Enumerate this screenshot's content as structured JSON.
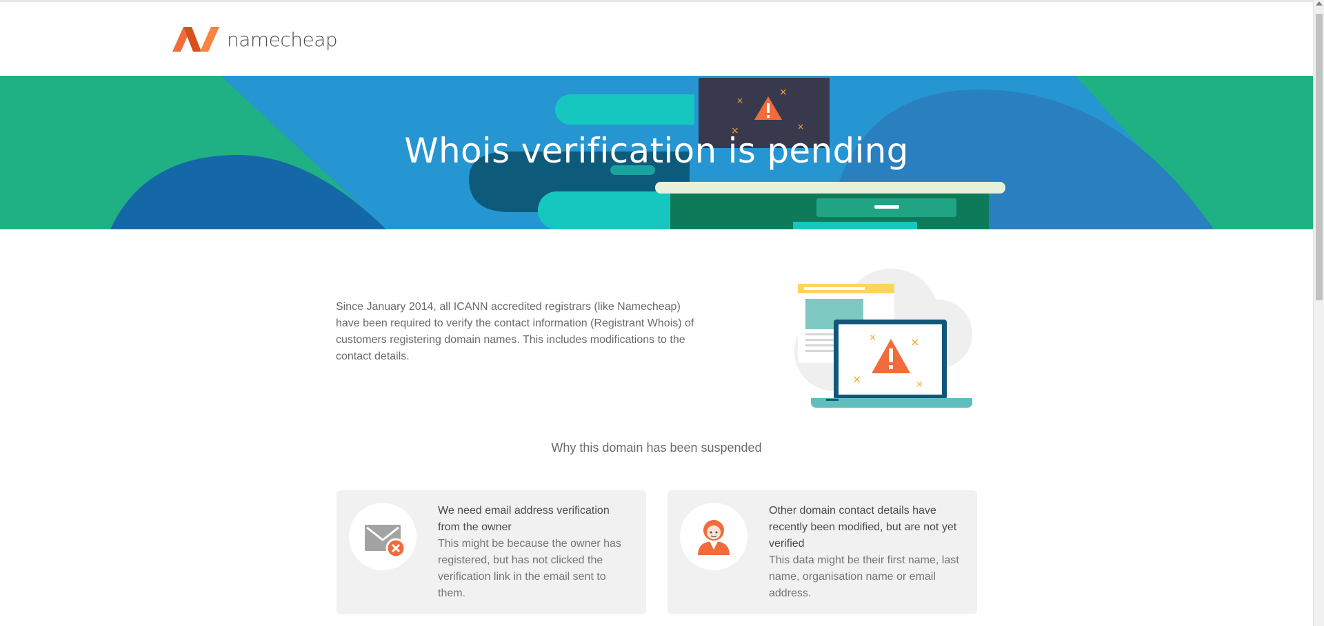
{
  "brand": {
    "name": "namecheap"
  },
  "hero": {
    "title": "Whois verification is pending"
  },
  "intro": {
    "text": "Since January 2014, all ICANN accredited registrars (like Namecheap) have been required to verify the contact information (Registrant Whois) of customers registering domain names. This includes modifications to the contact details."
  },
  "reasons": {
    "title": "Why this domain has been suspended",
    "items": [
      {
        "heading": "We need email address verification from the owner",
        "text": "This might be because the owner has registered, but has not clicked the verification link in the email sent to them.",
        "icon": "email-error-icon"
      },
      {
        "heading": "Other domain contact details have recently been modified, but are not yet verified",
        "text": "This data might be their first name, last name, organisation name or email address.",
        "icon": "user-icon"
      }
    ]
  },
  "colors": {
    "hero_green": "#1fb083",
    "hero_blue": "#2596d1",
    "accent_orange": "#f26b3a",
    "card_bg": "#f1f1f1"
  }
}
